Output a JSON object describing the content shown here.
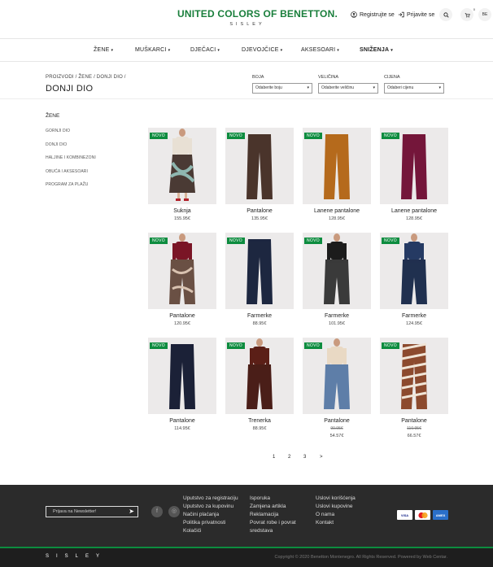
{
  "header": {
    "logo_main": "UNITED COLORS OF BENETTON.",
    "logo_sub": "SISLEY",
    "register": "Registrujte se",
    "login": "Prijavite se",
    "wishlist_count": "0",
    "cart_label": "BE"
  },
  "nav": {
    "items": [
      "ŽENE",
      "MUŠKARCI",
      "DJEČACI",
      "DJEVOJČICE",
      "AKSESOARI",
      "SNIŽENJA"
    ]
  },
  "titlebar": {
    "breadcrumb": "PROIZVODI / ŽENE / DONJI DIO /",
    "title": "DONJI DIO",
    "filters": [
      {
        "label": "BOJA",
        "value": "Odaberite boju"
      },
      {
        "label": "VELIČINA",
        "value": "Odaberite veličinu"
      },
      {
        "label": "CIJENA",
        "value": "Odaberi cijenu"
      }
    ]
  },
  "sidebar": {
    "title": "ŽENE",
    "items": [
      "GORNJI DIO",
      "DONJI DIO",
      "HALJINE I KOMBINEZONI",
      "OBUĆA I AKSESOARI",
      "PROGRAM ZA PLAŽU"
    ]
  },
  "products": [
    {
      "badge": "NOVO",
      "name": "Suknja",
      "price": "155.95€",
      "old_price": ""
    },
    {
      "badge": "NOVO",
      "name": "Pantalone",
      "price": "135.95€",
      "old_price": ""
    },
    {
      "badge": "NOVO",
      "name": "Lanene pantalone",
      "price": "128.95€",
      "old_price": ""
    },
    {
      "badge": "NOVO",
      "name": "Lanene pantalone",
      "price": "128.95€",
      "old_price": ""
    },
    {
      "badge": "NOVO",
      "name": "Pantalone",
      "price": "120.95€",
      "old_price": ""
    },
    {
      "badge": "NOVO",
      "name": "Farmerke",
      "price": "88.95€",
      "old_price": ""
    },
    {
      "badge": "NOVO",
      "name": "Farmerke",
      "price": "101.95€",
      "old_price": ""
    },
    {
      "badge": "NOVO",
      "name": "Farmerke",
      "price": "124.95€",
      "old_price": ""
    },
    {
      "badge": "NOVO",
      "name": "Pantalone",
      "price": "114.95€",
      "old_price": ""
    },
    {
      "badge": "NOVO",
      "name": "Trenerka",
      "price": "88.95€",
      "old_price": ""
    },
    {
      "badge": "NOVO",
      "name": "Pantalone",
      "price": "54.57€",
      "old_price": "90.95€"
    },
    {
      "badge": "NOVO",
      "name": "Pantalone",
      "price": "66.57€",
      "old_price": "110.95€"
    }
  ],
  "pagination": [
    "1",
    "2",
    "3",
    ">"
  ],
  "footer": {
    "newsletter_placeholder": "Prijava na Newsletter!",
    "col1": [
      "Uputstvo za registraciju",
      "Uputstvo za kupovinu",
      "Načini plaćanja",
      "Politika privatnosti",
      "Kolačići"
    ],
    "col2": [
      "Isporuka",
      "Zamjena artikla",
      "Reklamacija",
      "Povrat robe i povrat",
      "sredstava"
    ],
    "col3": [
      "Uslovi korišćenja",
      "Uslovi kupovine",
      "O nama",
      "Kontakt"
    ],
    "payments": [
      "VISA",
      "MC",
      "AMEX"
    ],
    "brand": "SISLEY",
    "copyright": "Copyright © 2020 Benetton Montenegro. All Rights Reserved. Powered by Web Centar."
  },
  "colors": {
    "brand_green": "#0d8c3f",
    "footer_bg": "#2b2b2b"
  }
}
